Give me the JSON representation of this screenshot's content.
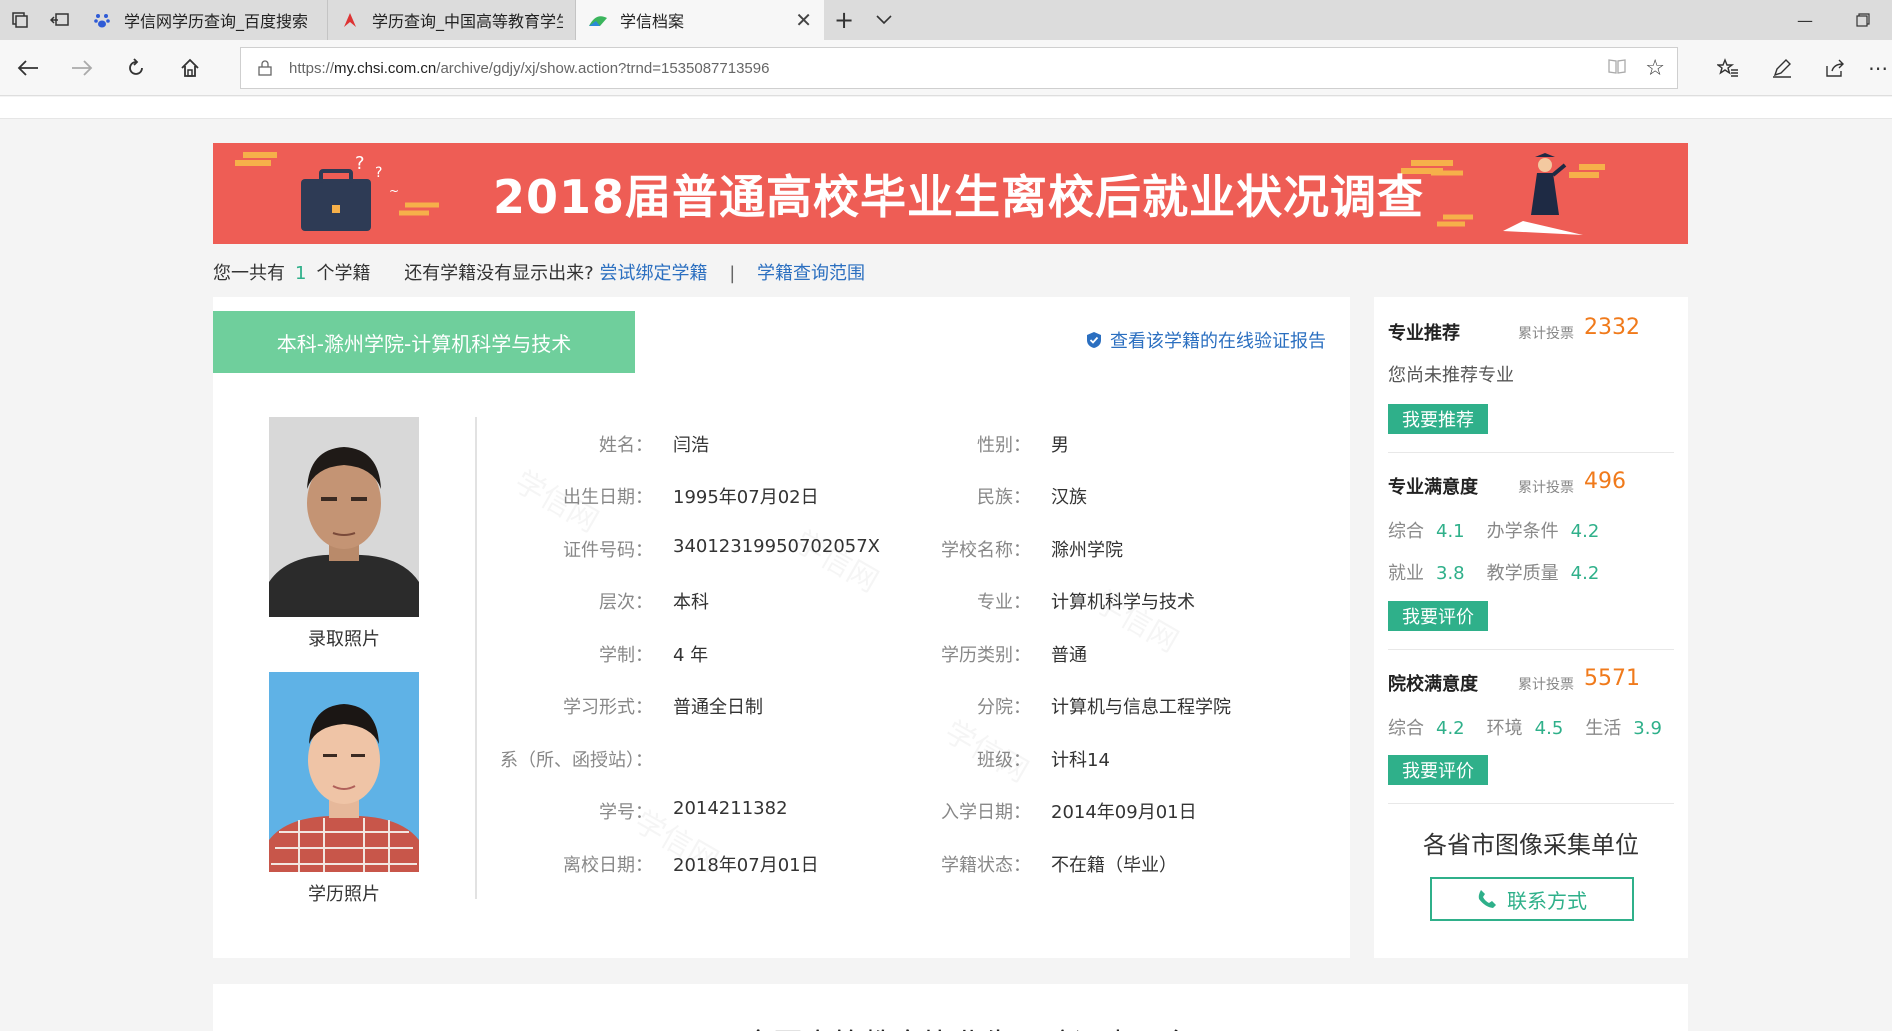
{
  "browser": {
    "tabs": [
      {
        "title": "学信网学历查询_百度搜索"
      },
      {
        "title": "学历查询_中国高等教育学生"
      },
      {
        "title": "学信档案"
      }
    ],
    "url_prefix": "https://",
    "url_host": "my.chsi.com.cn",
    "url_path": "/archive/gdjy/xj/show.action?trnd=1535087713596"
  },
  "banner": {
    "title": "2018届普通高校毕业生离校后就业状况调查"
  },
  "summary": {
    "prefix": "您一共有",
    "count": "1",
    "suffix": "个学籍",
    "question": "还有学籍没有显示出来?",
    "bind_link": "尝试绑定学籍",
    "separator": "|",
    "scope_link": "学籍查询范围"
  },
  "record": {
    "tab_label": "本科-滁州学院-计算机科学与技术",
    "verify_link": "查看该学籍的在线验证报告",
    "photo_admission_caption": "录取照片",
    "photo_degree_caption": "学历照片",
    "watermark": "学信网",
    "fields_left": [
      {
        "label": "姓名：",
        "value": "闫浩"
      },
      {
        "label": "出生日期：",
        "value": "1995年07月02日"
      },
      {
        "label": "证件号码：",
        "value": "34012319950702057X"
      },
      {
        "label": "层次：",
        "value": "本科"
      },
      {
        "label": "学制：",
        "value": "4 年"
      },
      {
        "label": "学习形式：",
        "value": "普通全日制"
      },
      {
        "label": "系（所、函授站）：",
        "value": ""
      },
      {
        "label": "学号：",
        "value": "2014211382"
      },
      {
        "label": "离校日期：",
        "value": "2018年07月01日"
      }
    ],
    "fields_right": [
      {
        "label": "性别：",
        "value": "男"
      },
      {
        "label": "民族：",
        "value": "汉族"
      },
      {
        "label": "学校名称：",
        "value": "滁州学院"
      },
      {
        "label": "专业：",
        "value": "计算机科学与技术"
      },
      {
        "label": "学历类别：",
        "value": "普通"
      },
      {
        "label": "分院：",
        "value": "计算机与信息工程学院"
      },
      {
        "label": "班级：",
        "value": "计科14"
      },
      {
        "label": "入学日期：",
        "value": "2014年09月01日"
      },
      {
        "label": "学籍状态：",
        "value": "不在籍（毕业）"
      }
    ]
  },
  "sidebar": {
    "major_rec": {
      "title": "专业推荐",
      "votes_label": "累计投票",
      "votes": "2332",
      "empty_text": "您尚未推荐专业",
      "button": "我要推荐"
    },
    "major_sat": {
      "title": "专业满意度",
      "votes_label": "累计投票",
      "votes": "496",
      "row1": [
        {
          "k": "综合",
          "v": "4.1"
        },
        {
          "k": "办学条件",
          "v": "4.2"
        }
      ],
      "row2": [
        {
          "k": "就业",
          "v": "3.8"
        },
        {
          "k": "教学质量",
          "v": "4.2"
        }
      ],
      "button": "我要评价"
    },
    "school_sat": {
      "title": "院校满意度",
      "votes_label": "累计投票",
      "votes": "5571",
      "row1": [
        {
          "k": "综合",
          "v": "4.2"
        },
        {
          "k": "环境",
          "v": "4.5"
        },
        {
          "k": "生活",
          "v": "3.9"
        }
      ],
      "button": "我要评价"
    },
    "image_units": "各省市图像采集单位",
    "contact_button": "联系方式"
  },
  "bottom": {
    "partial_text": "全国高等教育毕业生跟踪调查平台"
  },
  "colors": {
    "accent_green": "#2fb08a",
    "tab_green": "#6fcf9c",
    "banner_red": "#ee5d55",
    "link_blue": "#2b6fc0",
    "vote_orange": "#f07a1b"
  }
}
